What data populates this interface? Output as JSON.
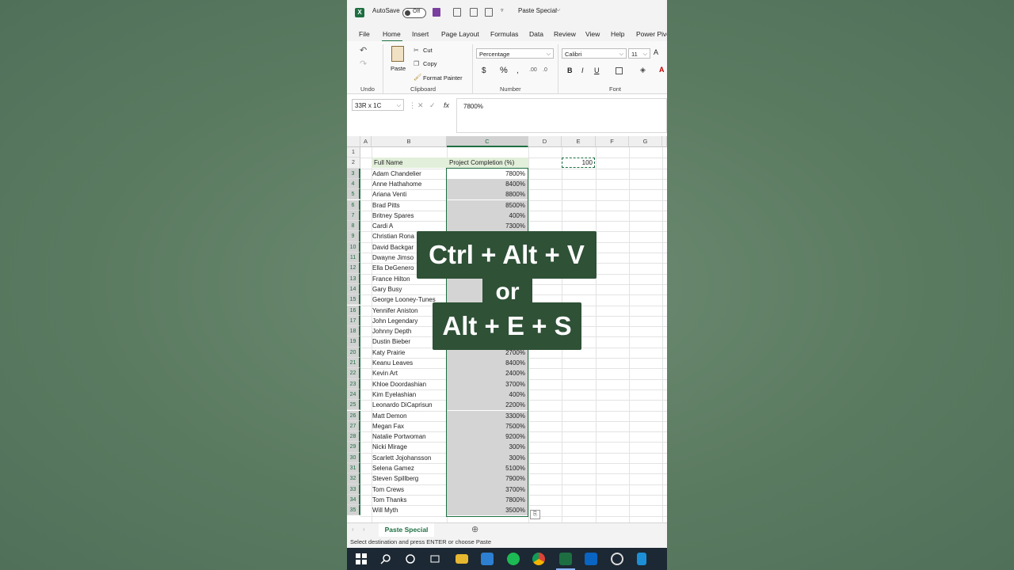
{
  "titlebar": {
    "autosave_label": "AutoSave",
    "autosave_state": "Off",
    "doc_title": "Paste Special",
    "doc_title_chevron": "⌵"
  },
  "tabs": [
    "File",
    "Home",
    "Insert",
    "Page Layout",
    "Formulas",
    "Data",
    "Review",
    "View",
    "Help",
    "Power Pivo"
  ],
  "ribbon": {
    "undo_label": "Undo",
    "paste_label": "Paste",
    "cut_label": "Cut",
    "copy_label": "Copy",
    "format_painter_label": "Format Painter",
    "clipboard_label": "Clipboard",
    "number_format": "Percentage",
    "number_label": "Number",
    "font_name": "Calibri",
    "font_size": "11",
    "font_label": "Font"
  },
  "formula_bar": {
    "name_box": "33R x 1C",
    "fx_label": "fx",
    "value": "7800%"
  },
  "columns": [
    "A",
    "B",
    "C",
    "D",
    "E",
    "F",
    "G"
  ],
  "header_row": {
    "full_name": "Full Name",
    "project_completion": "Project Completion (%)"
  },
  "copied_value": "100",
  "rows": [
    {
      "name": "Adam Chandelier",
      "pct": "7800%"
    },
    {
      "name": "Anne Hathahome",
      "pct": "8400%"
    },
    {
      "name": "Ariana Venti",
      "pct": "8800%"
    },
    {
      "name": "Brad Pitts",
      "pct": "8500%"
    },
    {
      "name": "Britney Spares",
      "pct": "400%"
    },
    {
      "name": "Cardi A",
      "pct": "7300%"
    },
    {
      "name": "Christian Rona",
      "pct": ""
    },
    {
      "name": "David Backgar",
      "pct": ""
    },
    {
      "name": "Dwayne Jimso",
      "pct": ""
    },
    {
      "name": "Ella DeGenero",
      "pct": ""
    },
    {
      "name": "France Hilton",
      "pct": ""
    },
    {
      "name": "Gary Busy",
      "pct": ""
    },
    {
      "name": "George Looney-Tunes",
      "pct": ""
    },
    {
      "name": "Yennifer Aniston",
      "pct": ""
    },
    {
      "name": "John Legendary",
      "pct": ""
    },
    {
      "name": "Johnny Depth",
      "pct": ""
    },
    {
      "name": "Dustin Bieber",
      "pct": ""
    },
    {
      "name": "Katy Prairie",
      "pct": "2700%"
    },
    {
      "name": "Keanu Leaves",
      "pct": "8400%"
    },
    {
      "name": "Kevin Art",
      "pct": "2400%"
    },
    {
      "name": "Khloe Doordashian",
      "pct": "3700%"
    },
    {
      "name": "Kim Eyelashian",
      "pct": "400%"
    },
    {
      "name": "Leonardo DiCaprisun",
      "pct": "2200%"
    },
    {
      "name": "Matt Demon",
      "pct": "3300%"
    },
    {
      "name": "Megan Fax",
      "pct": "7500%"
    },
    {
      "name": "Natalie Portwoman",
      "pct": "9200%"
    },
    {
      "name": "Nicki Mirage",
      "pct": "300%"
    },
    {
      "name": "Scarlett Jojohansson",
      "pct": "300%"
    },
    {
      "name": "Selena Gamez",
      "pct": "5100%"
    },
    {
      "name": "Steven Spillberg",
      "pct": "7900%"
    },
    {
      "name": "Tom Crews",
      "pct": "3700%"
    },
    {
      "name": "Tom Thanks",
      "pct": "7800%"
    },
    {
      "name": "Will Myth",
      "pct": "3500%"
    }
  ],
  "sheet_tab": "Paste Special",
  "status_text": "Select destination and press ENTER or choose Paste",
  "overlay": {
    "line1": "Ctrl + Alt + V",
    "line2": "or",
    "line3": "Alt + E + S"
  },
  "colors": {
    "excel_green": "#1d6f42",
    "overlay_bg": "#2f5136",
    "header_fill": "#e2efda"
  }
}
